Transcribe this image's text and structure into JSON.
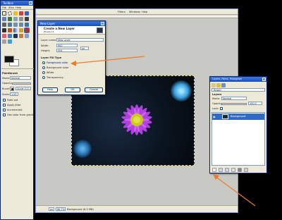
{
  "toolbox": {
    "title": "Toolbox",
    "menu": [
      "File",
      "Xtns",
      "Help"
    ],
    "options_title": "Paintbrush",
    "mode_label": "Mode:",
    "mode_value": "Normal",
    "opacity_label": "Opacity:",
    "brush_label": "Brush:",
    "brush_name": "Circle (11) (5)",
    "scale_label": "Scale:",
    "scale_value": "1.00",
    "options": [
      "Fade out",
      "Apply Jitter",
      "Incremental",
      "Use color from gradient"
    ]
  },
  "image_window": {
    "menu": [
      "Filters",
      "Windows",
      "Help"
    ],
    "status_unit": "px",
    "status_zoom": "66.7%",
    "status_text": "Background (6.3 MB)"
  },
  "new_layer_dialog": {
    "title": "New Layer",
    "heading": "Create a New Layer",
    "subheading": "[flower]-1",
    "name_label": "Layer name:",
    "name_value": "New Layer",
    "width_label": "Width:",
    "width_value": "900",
    "height_label": "Height:",
    "height_value": "554",
    "fill_type_label": "Layer Fill Type",
    "fill_options": [
      "Foreground color",
      "Background color",
      "White",
      "Transparency"
    ],
    "selected_fill": "Foreground color",
    "help_button": "Help",
    "ok_button": "OK",
    "cancel_button": "Cancel"
  },
  "layers_dialog": {
    "title": "Layers, Paths, Histogram",
    "image_selector": "flower",
    "section": "Layers",
    "mode_label": "Mode:",
    "mode_value": "Normal",
    "opacity_label": "Opacity:",
    "opacity_value": "100.0",
    "lock_label": "Lock:",
    "layer_name": "Background"
  },
  "colors": {
    "annotation_arrow": "#f07a28",
    "title_bar": "#245edb",
    "dialog_bg": "#ece9d8"
  }
}
